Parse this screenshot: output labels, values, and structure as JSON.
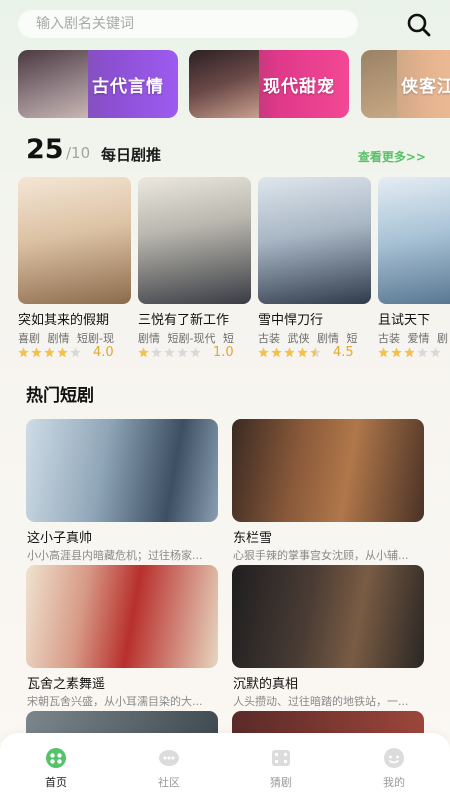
{
  "search": {
    "placeholder": "输入剧名关键词"
  },
  "categories": [
    {
      "label": "古代言情"
    },
    {
      "label": "现代甜宠"
    },
    {
      "label": "侠客江"
    }
  ],
  "daily": {
    "day": "25",
    "month": "/10",
    "title": "每日剧推",
    "more": "查看更多>>",
    "items": [
      {
        "name": "突如其来的假期",
        "tags": "喜剧 剧情 短剧-现",
        "rating": 4.0,
        "score": "4.0"
      },
      {
        "name": "三悦有了新工作",
        "tags": "剧情 短剧-现代 短",
        "rating": 1.0,
        "score": "1.0"
      },
      {
        "name": "雪中悍刀行",
        "tags": "古装 武侠 剧情 短",
        "rating": 4.5,
        "score": "4.5"
      },
      {
        "name": "且试天下",
        "tags": "古装 爱情 剧",
        "rating": 3.0,
        "score": ""
      }
    ]
  },
  "hot": {
    "title": "热门短剧",
    "items": [
      {
        "name": "这小子真帅",
        "desc": "小小高涯县内暗藏危机；过往杨家..."
      },
      {
        "name": "东栏雪",
        "desc": "心狠手辣的掌事宫女沈顾，从小辅..."
      },
      {
        "name": "瓦舍之素舞遥",
        "desc": "宋朝瓦舍兴盛，从小耳濡目染的大..."
      },
      {
        "name": "沉默的真相",
        "desc": "人头攒动、过往暗踏的地铁站，一..."
      }
    ]
  },
  "tabs": [
    {
      "label": "首页",
      "icon": "home-icon",
      "active": true
    },
    {
      "label": "社区",
      "icon": "community-icon",
      "active": false
    },
    {
      "label": "猜剧",
      "icon": "guess-drama-icon",
      "active": false
    },
    {
      "label": "我的",
      "icon": "profile-icon",
      "active": false
    }
  ],
  "colors": {
    "accent": "#5cc06a",
    "star": "#f2c14e",
    "star_empty": "#d9d9d9",
    "score": "#e3a72f"
  }
}
